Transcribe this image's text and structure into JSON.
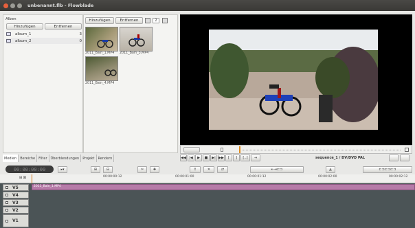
{
  "window": {
    "title": "unbenannt.flb - Flowblade"
  },
  "albums": {
    "header": "Alben",
    "add": "Hinzufügen",
    "remove": "Entfernen",
    "items": [
      {
        "name": "album_1",
        "count": "3"
      },
      {
        "name": "album_2",
        "count": "0"
      }
    ]
  },
  "media": {
    "add": "Hinzufügen",
    "remove": "Entfernen",
    "columns": "2",
    "files": [
      "2011_Bain_1.MP4",
      "2011_Bain_3.MP4",
      "2011_Bain_4.MP4"
    ]
  },
  "tabs": [
    "Medien",
    "Bereiche",
    "Filter",
    "Überblendungen",
    "Projekt",
    "Rendern"
  ],
  "monitor": {
    "sequence": "sequence_1 / DV/DVD PAL"
  },
  "timeline": {
    "timecode": "00:00:00:00",
    "ruler": [
      "00:00:00:12",
      "00:00:01:00",
      "00:00:01:12",
      "00:00:02:00",
      "00:00:02:12"
    ],
    "tracks": [
      {
        "name": "V5"
      },
      {
        "name": "V4"
      },
      {
        "name": "V3"
      },
      {
        "name": "V2"
      },
      {
        "name": "V1"
      }
    ],
    "clip_label": "2011_Bain_1.MP4"
  }
}
